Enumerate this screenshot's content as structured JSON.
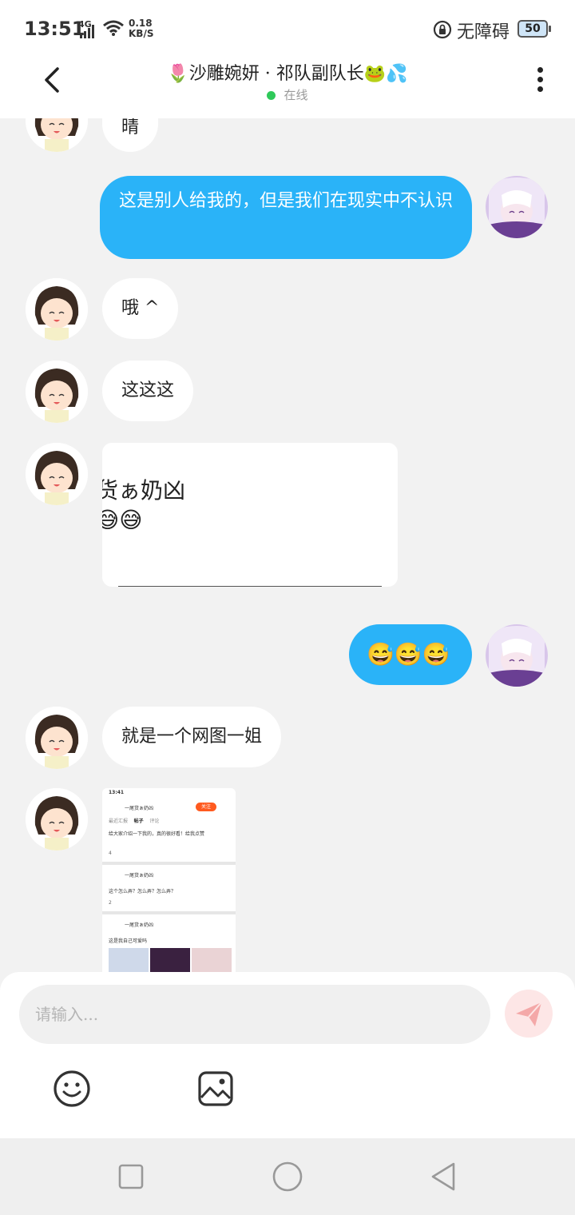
{
  "status_bar": {
    "time": "13:51",
    "network": "4G",
    "speed_value": "0.18",
    "speed_unit": "KB/S",
    "accessibility": "无障碍",
    "battery": "50"
  },
  "header": {
    "title": "🌷沙雕婉妍 · 祁队副队长🐸💦",
    "status": "在线"
  },
  "messages": [
    {
      "side": "left",
      "text": "晴"
    },
    {
      "side": "right",
      "text": "这是别人给我的，但是我们在现实中不认识"
    },
    {
      "side": "left",
      "text": "哦 ^"
    },
    {
      "side": "left",
      "text": "这这这"
    },
    {
      "side": "left",
      "type": "card",
      "line1": "货ぁ奶凶",
      "line2": "😅😅"
    },
    {
      "side": "right",
      "text": "😅😅😅"
    },
    {
      "side": "left",
      "text": "就是一个网图一姐"
    },
    {
      "side": "left",
      "type": "screenshot"
    }
  ],
  "screenshot": {
    "time": "13:41",
    "name": "一尾货ぁ奶凶",
    "follow": "关注",
    "tabs": [
      "最近汇报",
      "帖子",
      "评论"
    ],
    "post1": "给大家介绍一下我的，真的很好看！给我点赞",
    "post1_likes": "4",
    "post2_name": "一尾货ぁ奶凶",
    "post2_text": "这个怎么弄？怎么弄？怎么弄？",
    "post2_likes": "2",
    "post3_name": "一尾货ぁ奶凶",
    "post3_text": "这是我自己可爱吗"
  },
  "composer": {
    "placeholder": "请输入..."
  }
}
